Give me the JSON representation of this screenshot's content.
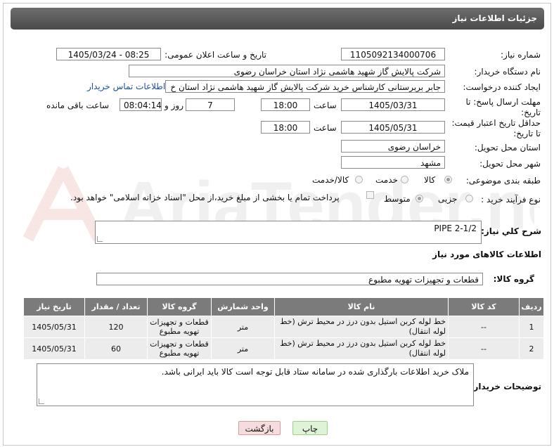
{
  "header": {
    "title": "جزئیات اطلاعات نیاز"
  },
  "fields": {
    "need_number_label": "شماره نیاز:",
    "need_number": "1105092134000706",
    "announce_label": "تاریخ و ساعت اعلان عمومی:",
    "announce_value": "1405/03/24 - 08:25",
    "buyer_label": "نام دستگاه خریدار:",
    "buyer_value": "شرکت پالایش گاز شهید هاشمی نژاد   استان خراسان رضوی",
    "creator_label": "ایجاد کننده درخواست:",
    "creator_value": "جابر بربرستانی کارشناس خرید شرکت پالایش گاز شهید هاشمی نژاد   استان خ",
    "contact_link": "اطلاعات تماس خریدار",
    "deadline_label_1": "مهلت ارسال پاسخ: تا",
    "deadline_label_2": "تاریخ:",
    "deadline_date": "1405/03/31",
    "time_word": "ساعت",
    "deadline_time": "18:00",
    "days_value": "7",
    "days_word": "روز و",
    "remaining_time": "08:04:14",
    "remaining_word": "ساعت باقی مانده",
    "price_label_1": "حداقل تاریخ اعتبار قیمت:",
    "price_label_2": "تا تاریخ:",
    "price_date": "1405/05/31",
    "price_time": "18:00",
    "province_label": "استان محل تحویل:",
    "province_value": "خراسان رضوی",
    "city_label": "شهر محل تحویل:",
    "city_value": "مشهد",
    "category_label": "طبقه بندی موضوعی:",
    "category_options": [
      "کالا",
      "خدمت",
      "کالا/خدمت"
    ],
    "process_label": "نوع فرآیند خرید :",
    "process_options": [
      "جزیی",
      "متوسط"
    ],
    "payment_note": "پرداخت تمام یا بخشی از مبلغ خرید،از محل \"اسناد خزانه اسلامی\" خواهد بود.",
    "summary_label": "شرح کلي نياز:",
    "summary_value": "PIPE 2-1/2",
    "goods_info_title": "اطلاعات کالاهای مورد نیاز",
    "goods_group_label": "گروه کالا:",
    "goods_group_value": "قطعات و تجهیزات تهویه مطبوع",
    "buyer_notes_label": "توضیحات خریدار:",
    "buyer_notes_value": "ملاک خرید اطلاعات بارگذاری شده در سامانه ستاد قابل توجه است کالا باید ایرانی باشد."
  },
  "table": {
    "headers": [
      "ردیف",
      "کد کالا",
      "نام کالا",
      "واحد شمارش",
      "گروه کالا",
      "تعداد / مقدار",
      "تاریخ نیاز"
    ],
    "rows": [
      [
        "1",
        "--",
        "خط لوله کربن استیل بدون درز در محیط ترش (خط لوله انتقال)",
        "متر",
        "قطعات و تجهیزات تهویه مطبوع",
        "120",
        "1405/05/31"
      ],
      [
        "2",
        "--",
        "خط لوله کربن استیل بدون درز در محیط ترش (خط لوله انتقال)",
        "متر",
        "قطعات و تجهیزات تهویه مطبوع",
        "60",
        "1405/05/31"
      ]
    ]
  },
  "buttons": {
    "print": "چاپ",
    "back": "بازگشت"
  },
  "watermark_text": "AriaTender.neT",
  "colors": {
    "header_bg": "#5a5a5a",
    "table_header": "#7b7b7b",
    "link": "#1a4fa3",
    "print_btn": "#dff3d6",
    "back_btn": "#f6dcdc"
  }
}
